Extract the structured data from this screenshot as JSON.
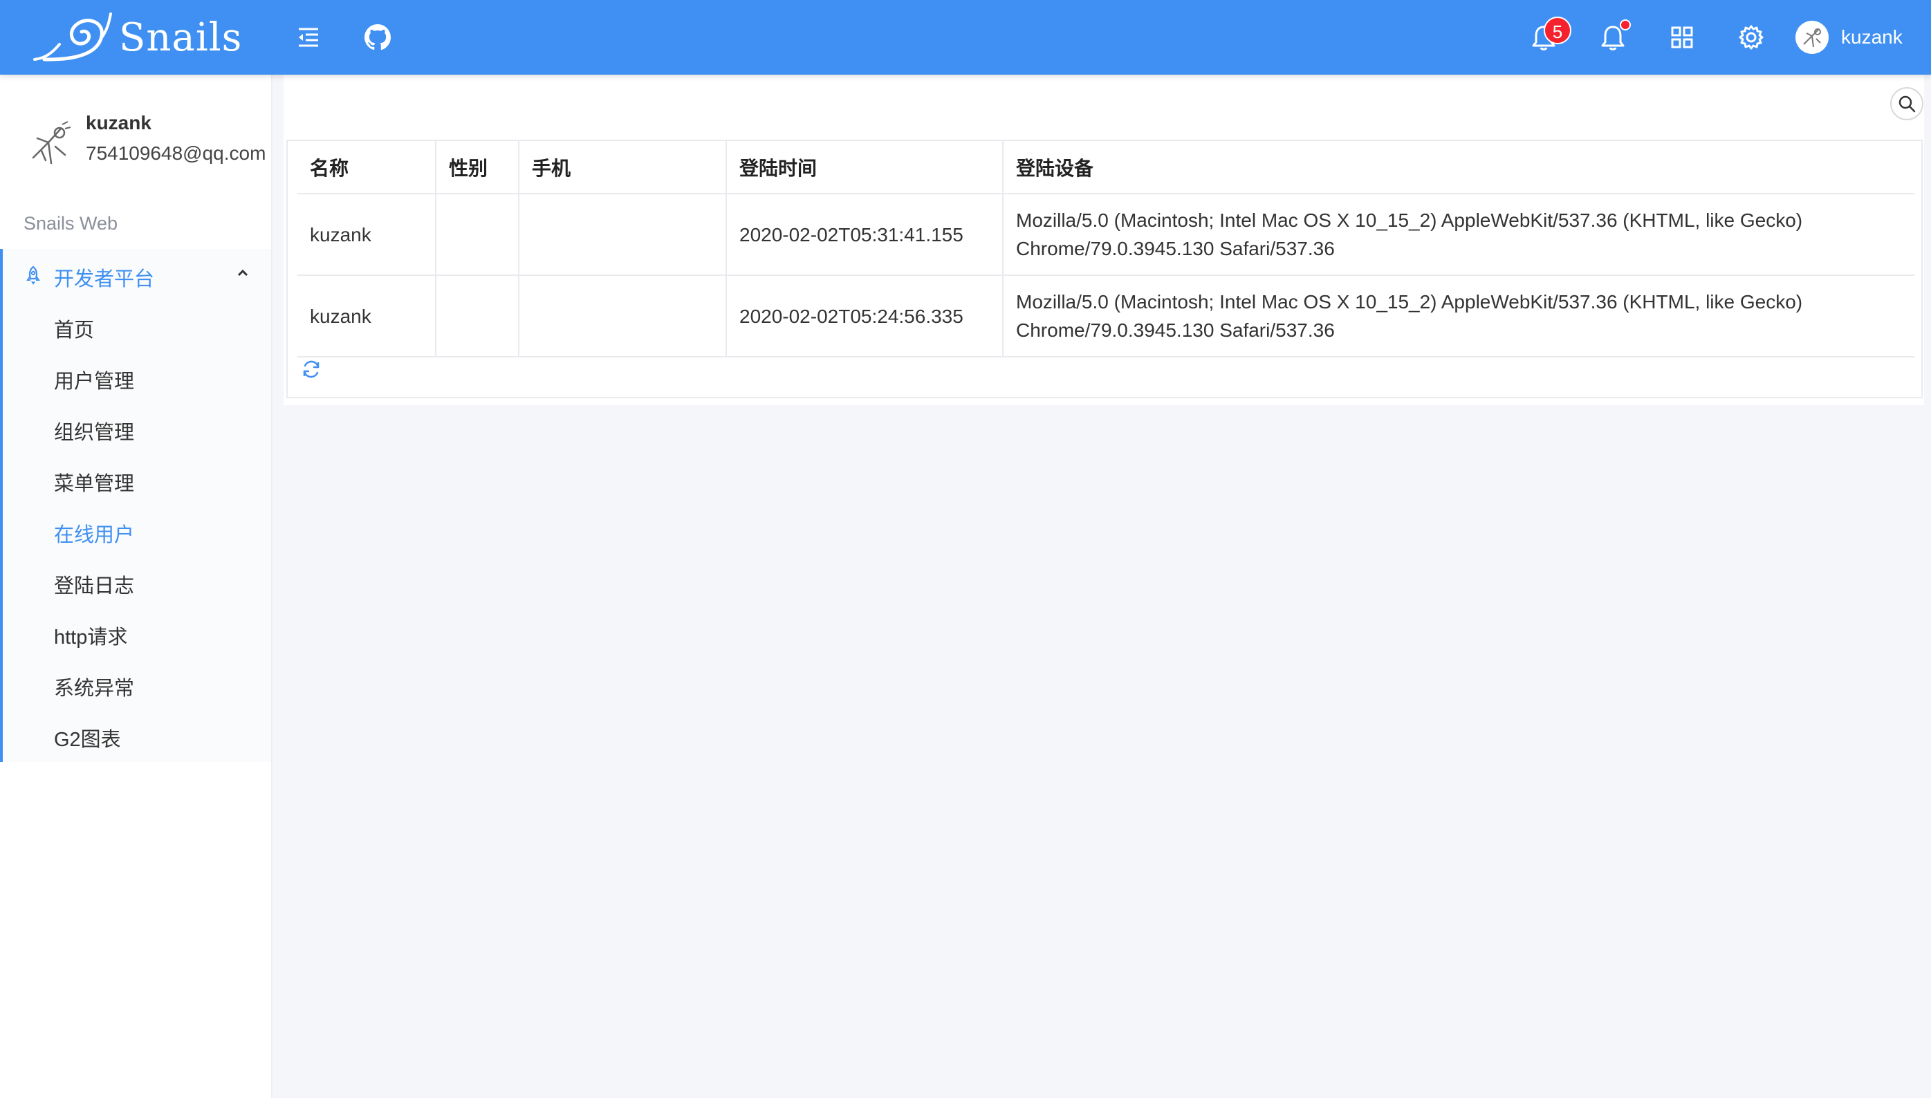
{
  "header": {
    "logo_text": "Snails",
    "notification_count": "5",
    "username": "kuzank"
  },
  "sidebar": {
    "profile": {
      "name": "kuzank",
      "email": "754109648@qq.com"
    },
    "group_title": "Snails Web",
    "submenu_title": "开发者平台",
    "items": [
      {
        "label": "首页"
      },
      {
        "label": "用户管理"
      },
      {
        "label": "组织管理"
      },
      {
        "label": "菜单管理"
      },
      {
        "label": "在线用户",
        "active": true
      },
      {
        "label": "登陆日志"
      },
      {
        "label": "http请求"
      },
      {
        "label": "系统异常"
      },
      {
        "label": "G2图表"
      }
    ]
  },
  "table": {
    "columns": [
      "名称",
      "性别",
      "手机",
      "登陆时间",
      "登陆设备"
    ],
    "rows": [
      [
        "kuzank",
        "",
        "",
        "2020-02-02T05:31:41.155",
        "Mozilla/5.0 (Macintosh; Intel Mac OS X 10_15_2) AppleWebKit/537.36 (KHTML, like Gecko) Chrome/79.0.3945.130 Safari/537.36"
      ],
      [
        "kuzank",
        "",
        "",
        "2020-02-02T05:24:56.335",
        "Mozilla/5.0 (Macintosh; Intel Mac OS X 10_15_2) AppleWebKit/537.36 (KHTML, like Gecko) Chrome/79.0.3945.130 Safari/537.36"
      ]
    ]
  },
  "icons": {
    "menu_fold": "menu-fold-icon",
    "github": "github-icon",
    "bell": "bell-icon",
    "apps": "apps-grid-icon",
    "settings": "gear-icon",
    "search": "search-icon",
    "refresh": "refresh-icon",
    "rocket": "rocket-icon",
    "chevron": "chevron-up-icon"
  },
  "colors": {
    "primary": "#3f90f2",
    "badge": "#f5222d"
  }
}
